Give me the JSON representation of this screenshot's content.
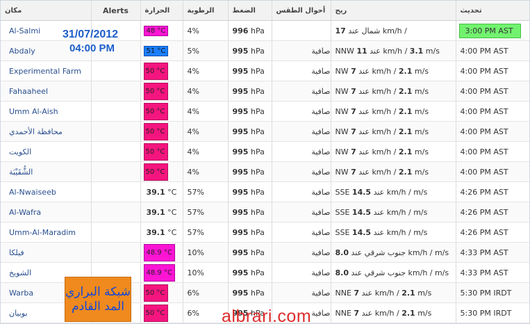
{
  "headers": {
    "location": "مكان",
    "alerts": "Alerts",
    "temperature": "الحرارة",
    "humidity": "الرطوبة",
    "pressure": "الضغط",
    "conditions": "أحوال الطقس",
    "wind": "ريح",
    "updated": "تحديث"
  },
  "overlay": {
    "date": "31/07/2012",
    "time": "04:00 PM",
    "logo_line1": "شبكة البراري",
    "logo_line2": "المد القادم",
    "watermark": "albrari.com"
  },
  "colors": {
    "magenta": "#ff14d4",
    "blue": "#1a7fff",
    "pink": "#f5157f",
    "green": "#72f26f",
    "orange": "#f08a1e",
    "link": "#2a4f8f"
  },
  "rows": [
    {
      "name": "Al-Salmi",
      "temp": "48 °C",
      "hum": "4%",
      "pres_val": "996",
      "pres_unit": "hPa",
      "cond": "",
      "wind_pre": "",
      "wind_a": "17",
      "wind_ar": "شمال عند",
      "wind_mid": "km/h /",
      "wind_b": "",
      "wind_post": "",
      "updated": "3:00 PM AST"
    },
    {
      "name": "Abdaly",
      "temp": "51 °C",
      "hum": "5%",
      "pres_val": "995",
      "pres_unit": "hPa",
      "cond": "صافية",
      "wind_pre": "NNW",
      "wind_a": "11",
      "wind_ar": "عند",
      "wind_mid": "km/h /",
      "wind_b": "3.1",
      "wind_post": "m/s",
      "updated": "4:00 PM AST"
    },
    {
      "name": "Experimental Farm",
      "temp": "50 °C",
      "hum": "4%",
      "pres_val": "995",
      "pres_unit": "hPa",
      "cond": "صافية",
      "wind_pre": "NW",
      "wind_a": "7",
      "wind_ar": "عند",
      "wind_mid": "km/h /",
      "wind_b": "2.1",
      "wind_post": "m/s",
      "updated": "4:00 PM AST"
    },
    {
      "name": "Fahaaheel",
      "temp": "50 °C",
      "hum": "4%",
      "pres_val": "995",
      "pres_unit": "hPa",
      "cond": "صافية",
      "wind_pre": "NW",
      "wind_a": "7",
      "wind_ar": "عند",
      "wind_mid": "km/h /",
      "wind_b": "2.1",
      "wind_post": "m/s",
      "updated": "4:00 PM AST"
    },
    {
      "name": "Umm Al-Aish",
      "temp": "50 °C",
      "hum": "4%",
      "pres_val": "995",
      "pres_unit": "hPa",
      "cond": "صافية",
      "wind_pre": "NW",
      "wind_a": "7",
      "wind_ar": "عند",
      "wind_mid": "km/h /",
      "wind_b": "2.1",
      "wind_post": "m/s",
      "updated": "4:00 PM AST"
    },
    {
      "name": "محافظة الأحمدي",
      "temp": "50 °C",
      "hum": "4%",
      "pres_val": "995",
      "pres_unit": "hPa",
      "cond": "صافية",
      "wind_pre": "NW",
      "wind_a": "7",
      "wind_ar": "عند",
      "wind_mid": "km/h /",
      "wind_b": "2.1",
      "wind_post": "m/s",
      "updated": "4:00 PM AST"
    },
    {
      "name": "الكويت",
      "temp": "50 °C",
      "hum": "4%",
      "pres_val": "995",
      "pres_unit": "hPa",
      "cond": "صافية",
      "wind_pre": "NW",
      "wind_a": "7",
      "wind_ar": "عند",
      "wind_mid": "km/h /",
      "wind_b": "2.1",
      "wind_post": "m/s",
      "updated": "4:00 PM AST"
    },
    {
      "name": "الشُّقَيْبَة",
      "temp": "50 °C",
      "hum": "4%",
      "pres_val": "995",
      "pres_unit": "hPa",
      "cond": "صافية",
      "wind_pre": "NW",
      "wind_a": "7",
      "wind_ar": "عند",
      "wind_mid": "km/h /",
      "wind_b": "2.1",
      "wind_post": "m/s",
      "updated": "4:00 PM AST"
    },
    {
      "name": "Al-Nwaiseeb",
      "temp_num": "39.1",
      "temp_unit": "°C",
      "hum": "57%",
      "pres_val": "995",
      "pres_unit": "hPa",
      "cond": "صافية",
      "wind_pre": "SSE",
      "wind_a": "14.5",
      "wind_ar": "عند",
      "wind_mid": "km/h /",
      "wind_b": "",
      "wind_post": "m/s",
      "updated": "4:26 PM AST"
    },
    {
      "name": "Al-Wafra",
      "temp_num": "39.1",
      "temp_unit": "°C",
      "hum": "57%",
      "pres_val": "995",
      "pres_unit": "hPa",
      "cond": "صافية",
      "wind_pre": "SSE",
      "wind_a": "14.5",
      "wind_ar": "عند",
      "wind_mid": "km/h /",
      "wind_b": "",
      "wind_post": "m/s",
      "updated": "4:26 PM AST"
    },
    {
      "name": "Umm-Al-Maradim",
      "temp_num": "39.1",
      "temp_unit": "°C",
      "hum": "57%",
      "pres_val": "995",
      "pres_unit": "hPa",
      "cond": "صافية",
      "wind_pre": "SSE",
      "wind_a": "14.5",
      "wind_ar": "عند",
      "wind_mid": "km/h /",
      "wind_b": "",
      "wind_post": "m/s",
      "updated": "4:26 PM AST"
    },
    {
      "name": "فيلكا",
      "temp": "48.9 °C",
      "hum": "10%",
      "pres_val": "995",
      "pres_unit": "hPa",
      "cond": "صافية",
      "wind_pre": "",
      "wind_a": "8.0",
      "wind_ar": "جنوب شرقي عند",
      "wind_mid": "km/h /",
      "wind_b": "",
      "wind_post": "m/s",
      "updated": "4:33 PM AST"
    },
    {
      "name": "الشويخ",
      "temp": "48.9 °C",
      "hum": "10%",
      "pres_val": "995",
      "pres_unit": "hPa",
      "cond": "صافية",
      "wind_pre": "",
      "wind_a": "8.0",
      "wind_ar": "جنوب شرقي عند",
      "wind_mid": "km/h /",
      "wind_b": "",
      "wind_post": "m/s",
      "updated": "4:33 PM AST"
    },
    {
      "name": "Warba",
      "temp": "50 °C",
      "hum": "6%",
      "pres_val": "995",
      "pres_unit": "hPa",
      "cond": "صافية",
      "wind_pre": "NNE",
      "wind_a": "7",
      "wind_ar": "عند",
      "wind_mid": "km/h /",
      "wind_b": "2.1",
      "wind_post": "m/s",
      "updated": "5:30 PM IRDT"
    },
    {
      "name": "بوبيان",
      "temp": "50 °C",
      "hum": "6%",
      "pres_val": "995",
      "pres_unit": "hPa",
      "cond": "صافية",
      "wind_pre": "NNE",
      "wind_a": "7",
      "wind_ar": "عند",
      "wind_mid": "km/h /",
      "wind_b": "2.1",
      "wind_post": "m/s",
      "updated": "5:30 PM IRDT"
    }
  ]
}
